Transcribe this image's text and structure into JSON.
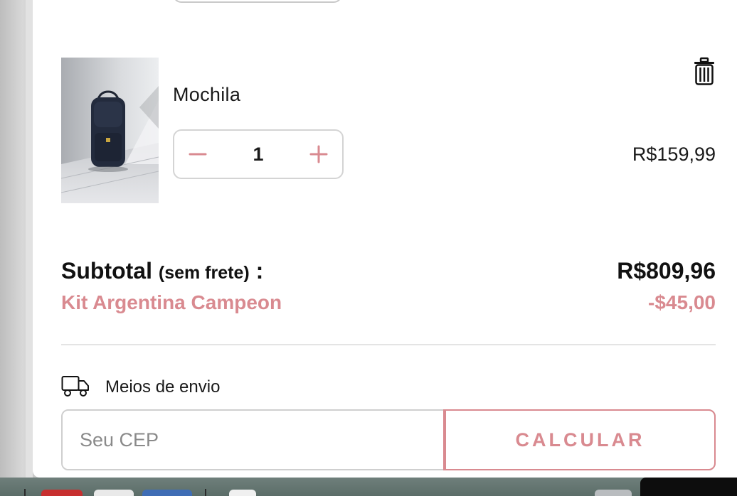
{
  "cart_item": {
    "name": "Mochila",
    "quantity": "1",
    "price": "R$159,99",
    "image_icon": "backpack-photo"
  },
  "summary": {
    "subtotal_label": "Subtotal",
    "subtotal_note": "(sem frete)",
    "subtotal_colon": " :",
    "subtotal_value": "R$809,96",
    "discount_label": "Kit Argentina Campeon",
    "discount_value": "-$45,00"
  },
  "shipping": {
    "label": "Meios de envio",
    "icon": "truck-icon",
    "cep_placeholder": "Seu CEP",
    "cep_value": "",
    "calculate_label": "CALCULAR"
  },
  "colors": {
    "accent": "#d98a90",
    "text": "#1a1a1a",
    "border": "#d4d4d4"
  }
}
